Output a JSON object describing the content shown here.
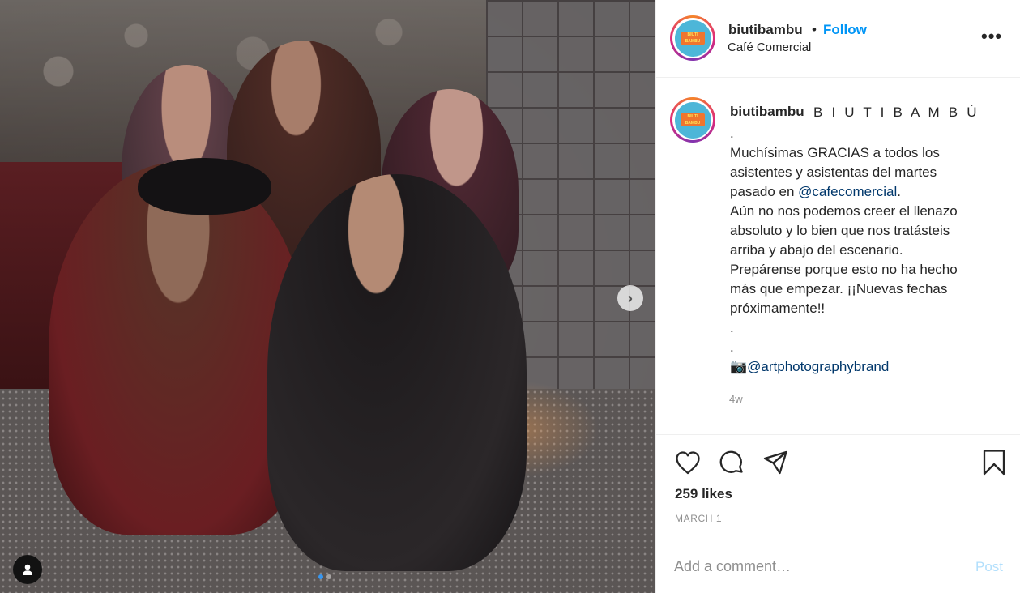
{
  "post": {
    "username": "biutibambu",
    "separator": "•",
    "follow_label": "Follow",
    "location": "Café Comercial",
    "more_label": "•••"
  },
  "avatar": {
    "logo_text": "BIUTI BAMBU",
    "ring_colors": [
      "#f58529",
      "#dd2a7b",
      "#8134af"
    ],
    "background_color": "#4db6d8"
  },
  "caption": {
    "username": "biutibambu",
    "display_name": "B I U T I B A M B Ú",
    "line_1": ".",
    "line_2": "Muchísimas GRACIAS a todos los",
    "line_3": "asistentes y asistentas del martes",
    "line_4_prefix": "pasado en ",
    "line_4_mention": "@cafecomercial",
    "line_4_suffix": ".",
    "line_5": "Aún no nos podemos creer el llenazo",
    "line_6": "absoluto y lo bien que nos tratásteis",
    "line_7": "arriba y abajo del escenario.",
    "line_8": "Prepárense porque esto no ha hecho",
    "line_9": "más que empezar. ¡¡Nuevas fechas",
    "line_10": "próximamente!!",
    "line_11": ".",
    "line_12": ".",
    "credit_emoji": "📷",
    "credit_mention": "@artphotographybrand",
    "time_ago": "4w"
  },
  "actions": {
    "icons": [
      "heart-icon",
      "comment-icon",
      "share-icon",
      "bookmark-icon"
    ],
    "likes": "259 likes",
    "date": "MARCH 1"
  },
  "comment": {
    "placeholder": "Add a comment…",
    "post_label": "Post"
  },
  "photo": {
    "next_label": "›",
    "slide_count": 2,
    "active_slide": 1
  },
  "colors": {
    "link_blue": "#0095f6",
    "mention_blue": "#00376b",
    "muted_gray": "#8e8e8e",
    "post_disabled": "#b2dffc"
  }
}
